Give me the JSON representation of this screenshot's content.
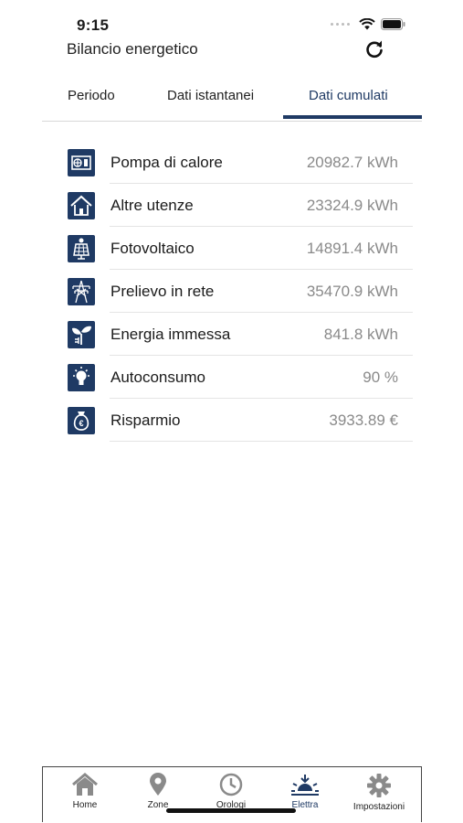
{
  "status_bar": {
    "time": "9:15"
  },
  "header": {
    "title": "Bilancio energetico"
  },
  "tabs": [
    {
      "label": "Periodo",
      "active": false
    },
    {
      "label": "Dati istantanei",
      "active": false
    },
    {
      "label": "Dati cumulati",
      "active": true
    }
  ],
  "rows": [
    {
      "icon": "heat-pump-icon",
      "label": "Pompa di calore",
      "value": "20982.7 kWh"
    },
    {
      "icon": "house-icon",
      "label": "Altre utenze",
      "value": "23324.9 kWh"
    },
    {
      "icon": "solar-panel-icon",
      "label": "Fotovoltaico",
      "value": "14891.4 kWh"
    },
    {
      "icon": "power-pylon-icon",
      "label": "Prelievo in rete",
      "value": "35470.9 kWh"
    },
    {
      "icon": "plug-leaf-icon",
      "label": "Energia immessa",
      "value": "841.8 kWh"
    },
    {
      "icon": "light-bulb-icon",
      "label": "Autoconsumo",
      "value": "90 %"
    },
    {
      "icon": "money-bag-icon",
      "label": "Risparmio",
      "value": "3933.89 €"
    }
  ],
  "tabbar": [
    {
      "icon": "home-icon",
      "label": "Home",
      "active": false
    },
    {
      "icon": "pin-icon",
      "label": "Zone",
      "active": false
    },
    {
      "icon": "clock-icon",
      "label": "Orologi",
      "active": false
    },
    {
      "icon": "sunrise-icon",
      "label": "Elettra",
      "active": true
    },
    {
      "icon": "gear-icon",
      "label": "Impostazioni",
      "active": false
    }
  ],
  "colors": {
    "accent": "#1f3a64",
    "value_text": "#8a8a8a",
    "tab_icon": "#8a8a8a"
  }
}
